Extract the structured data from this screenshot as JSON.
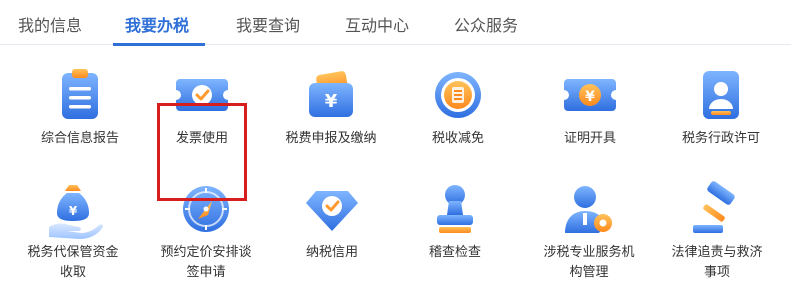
{
  "tabs": [
    {
      "label": "我的信息"
    },
    {
      "label": "我要办税"
    },
    {
      "label": "我要查询"
    },
    {
      "label": "互动中心"
    },
    {
      "label": "公众服务"
    }
  ],
  "active_tab": "我要办税",
  "highlight_color": "#d61e1e",
  "accent_color": "#2f6fd8",
  "services_row1": [
    {
      "label": "综合信息报告",
      "icon": "clipboard-icon"
    },
    {
      "label": "发票使用",
      "icon": "invoice-ticket-icon"
    },
    {
      "label": "税费申报及缴纳",
      "icon": "yuan-wallet-icon"
    },
    {
      "label": "税收减免",
      "icon": "tax-coin-icon"
    },
    {
      "label": "证明开具",
      "icon": "yuan-ticket-icon"
    },
    {
      "label": "税务行政许可",
      "icon": "id-badge-icon"
    }
  ],
  "services_row2": [
    {
      "label_lines": [
        "税务代保管资金",
        "收取"
      ],
      "icon": "money-bag-hand-icon"
    },
    {
      "label_lines": [
        "预约定价安排谈",
        "签申请"
      ],
      "icon": "compass-icon"
    },
    {
      "label_lines": [
        "纳税信用"
      ],
      "icon": "diamond-check-icon"
    },
    {
      "label_lines": [
        "稽查检查"
      ],
      "icon": "stamp-icon"
    },
    {
      "label_lines": [
        "涉税专业服务机",
        "构管理"
      ],
      "icon": "user-gear-icon"
    },
    {
      "label_lines": [
        "法律追责与救济",
        "事项"
      ],
      "icon": "gavel-icon"
    }
  ]
}
